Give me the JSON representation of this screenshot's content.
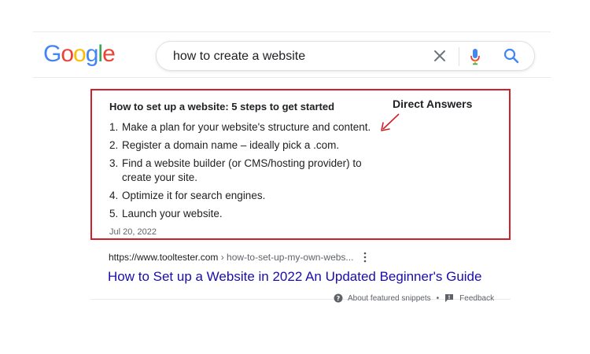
{
  "logo": {
    "text": "Google"
  },
  "search": {
    "query": "how to create a website"
  },
  "icons": {
    "clear": "close-icon",
    "mic": "microphone-icon",
    "search": "magnifier-icon",
    "more": "more-vertical-icon",
    "about": "question-circle-icon",
    "feedback": "feedback-icon",
    "annotation_arrow": "arrow-icon"
  },
  "snippet": {
    "title": "How to set up a website: 5 steps to get started",
    "annotation": "Direct Answers",
    "steps": [
      {
        "num": "1.",
        "text": "Make a plan for your website's structure and content."
      },
      {
        "num": "2.",
        "text": "Register a domain name – ideally pick a .com."
      },
      {
        "num": "3.",
        "text": "Find a website builder (or CMS/hosting provider) to create your site."
      },
      {
        "num": "4.",
        "text": "Optimize it for search engines."
      },
      {
        "num": "5.",
        "text": "Launch your website."
      }
    ],
    "date": "Jul 20, 2022"
  },
  "result": {
    "domain": "https://www.tooltester.com",
    "path": " › how-to-set-up-my-own-webs...",
    "title": "How to Set up a Website in 2022 An Updated Beginner's Guide"
  },
  "footer": {
    "about": "About featured snippets",
    "bullet": "•",
    "feedback": "Feedback"
  },
  "colors": {
    "highlight_border": "#d0202a",
    "link": "#1a0dab",
    "google_blue": "#4285F4",
    "google_red": "#EA4335",
    "google_yellow": "#FBBC05",
    "google_green": "#34A853"
  }
}
